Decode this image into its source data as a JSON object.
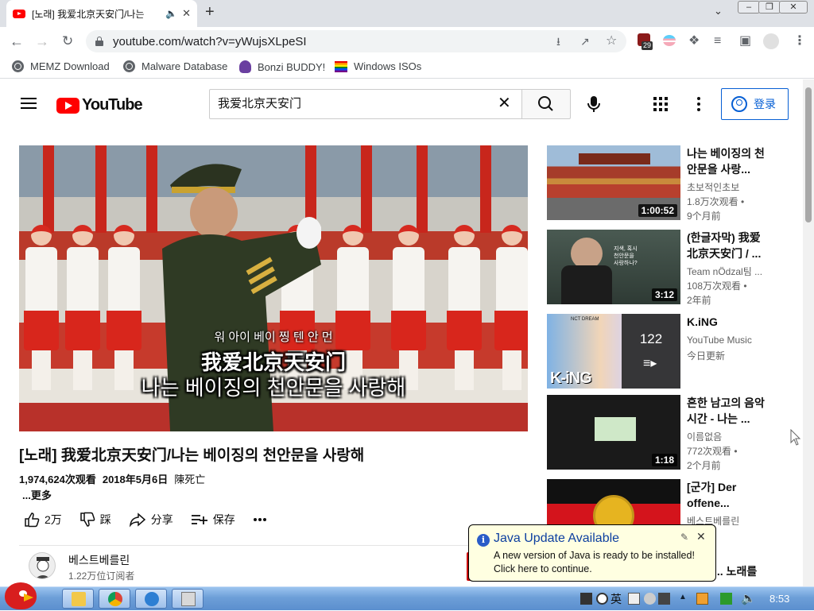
{
  "browser": {
    "tab_title": "[노래] 我爱北京天安门/나는",
    "url": "youtube.com/watch?v=yWujsXLpeSI",
    "extension_badge": "29",
    "bookmarks": [
      "MEMZ Download",
      "Malware Database",
      "Bonzi BUDDY!",
      "Windows ISOs"
    ]
  },
  "youtube": {
    "logo_text": "YouTube",
    "search_query": "我爱北京天安门",
    "signin_label": "登录"
  },
  "video": {
    "subtitle_korean_small": "워 아이 베이 찡 텐 안 먼",
    "subtitle_chinese": "我爱北京天安门",
    "subtitle_korean_big": "나는 베이징의 천안문을 사랑해",
    "title": "[노래] 我爱北京天安门/나는 베이징의 천안문을 사랑해",
    "views": "1,974,624次观看",
    "date": "2018年5月6日",
    "description_snippet": "陳死亡",
    "more_label": "...更多",
    "likes": "2万",
    "dislike_label": "踩",
    "share_label": "分享",
    "save_label": "保存",
    "channel_name": "베스트베를린",
    "channel_subs": "1.22万位订阅者"
  },
  "recommendations": [
    {
      "title": "나는 베이징의 천안문을 사랑...",
      "channel": "초보적인초보",
      "views": "1.8万次观看 •",
      "age": "9个月前",
      "duration": "1:00:52"
    },
    {
      "title": "(한글자막) 我爱北京天安门 / ...",
      "channel": "Team nÖdzal팀 ...",
      "views": "108万次观看 •",
      "age": "2年前",
      "duration": "3:12"
    },
    {
      "title": "K.iNG",
      "channel": "YouTube Music",
      "views": "今日更新",
      "age": "",
      "playlist_count": "122",
      "thumb_top_text": "NCT DREAM",
      "thumb_logo": "K-iNG"
    },
    {
      "title": "흔한 남고의 음악시간 - 나는 ...",
      "channel": "이름없음",
      "views": "772次观看 •",
      "age": "2个月前",
      "duration": "1:18"
    },
    {
      "title": "[군가] Der offene...",
      "channel": "베스트베를린",
      "views": "",
      "age": "",
      "duration": ""
    },
    {
      "title": "... 노래를",
      "channel": "",
      "views": "",
      "age": "",
      "duration": ""
    }
  ],
  "java_popup": {
    "title": "Java Update Available",
    "line1": "A new version of Java is ready to be installed!",
    "line2": "Click here to continue."
  },
  "taskbar": {
    "ime_label": "英",
    "clock": "8:53"
  }
}
